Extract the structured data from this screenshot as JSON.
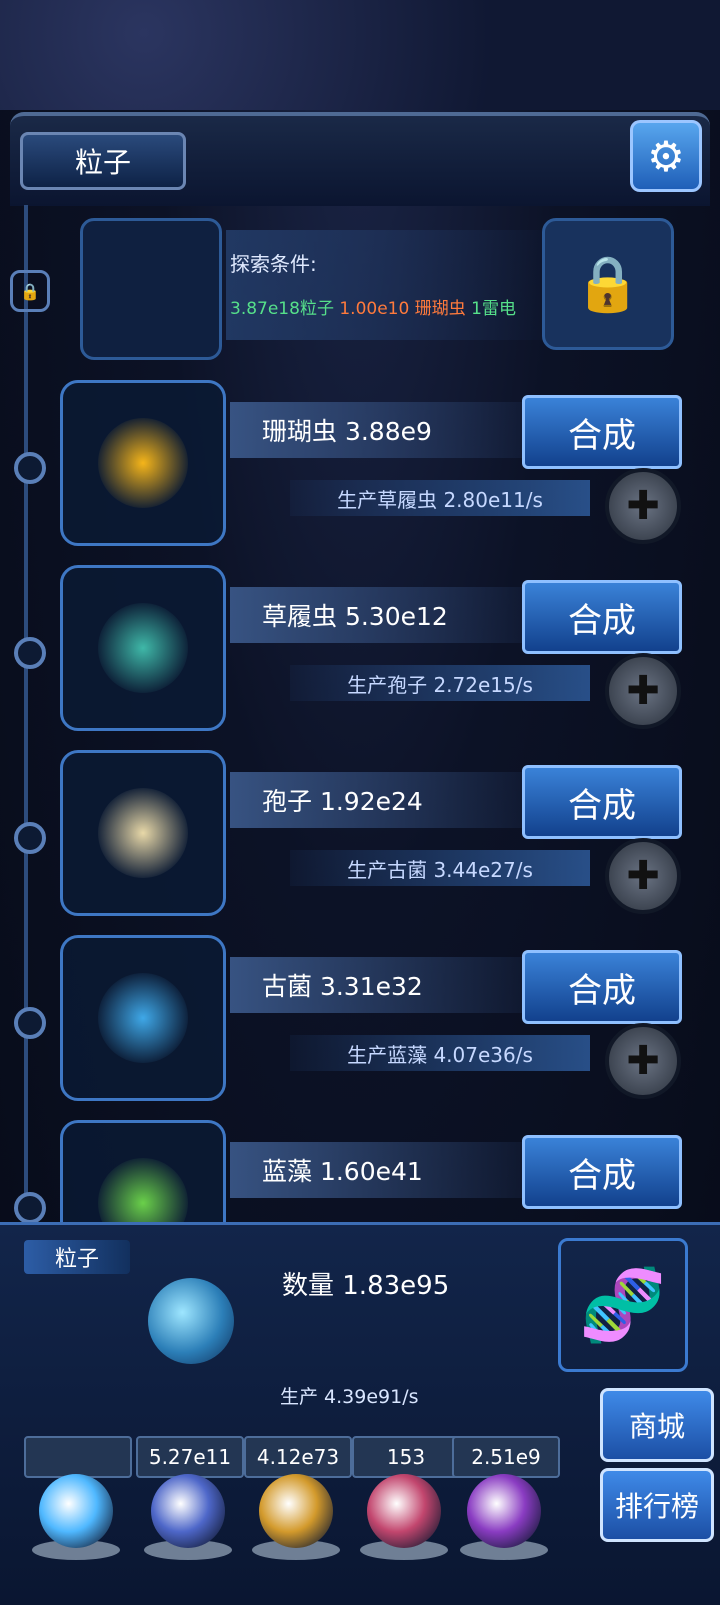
{
  "header": {
    "title": "粒子"
  },
  "explore": {
    "title": "探索条件:",
    "cond1": "3.87e18粒子",
    "cond2": "1.00e10 珊瑚虫",
    "cond3": "1雷电",
    "colors": {
      "cond1": "#56e08a",
      "cond2": "#ff7a3c",
      "cond3": "#56e08a"
    }
  },
  "rows": [
    {
      "name": "珊瑚虫 3.88e9",
      "button": "合成",
      "production": "生产草履虫 2.80e11/s",
      "icon": "sun-organism-icon"
    },
    {
      "name": "草履虫 5.30e12",
      "button": "合成",
      "production": "生产孢子 2.72e15/s",
      "icon": "paramecium-icon"
    },
    {
      "name": "孢子 1.92e24",
      "button": "合成",
      "production": "生产古菌 3.44e27/s",
      "icon": "spore-icon"
    },
    {
      "name": "古菌 3.31e32",
      "button": "合成",
      "production": "生产蓝藻 4.07e36/s",
      "icon": "bacteria-icon"
    },
    {
      "name": "蓝藻 1.60e41",
      "button": "合成",
      "production": "",
      "icon": "algae-icon"
    }
  ],
  "footer": {
    "tag": "粒子",
    "count": "数量 1.83e95",
    "production": "生产 4.39e91/s"
  },
  "resources": [
    {
      "value": "",
      "color": "#4fb8ff",
      "icon": "particle-orb-icon"
    },
    {
      "value": "5.27e11",
      "color": "#4e67c9",
      "icon": "lightning-orb-icon"
    },
    {
      "value": "4.12e73",
      "color": "#d39a2c",
      "icon": "fire-orb-icon"
    },
    {
      "value": "153",
      "color": "#c2466e",
      "icon": "brain-orb-icon"
    },
    {
      "value": "2.51e9",
      "color": "#8a3cc2",
      "icon": "vortex-orb-icon"
    }
  ],
  "side": {
    "shop": "商城",
    "rank": "排行榜"
  }
}
